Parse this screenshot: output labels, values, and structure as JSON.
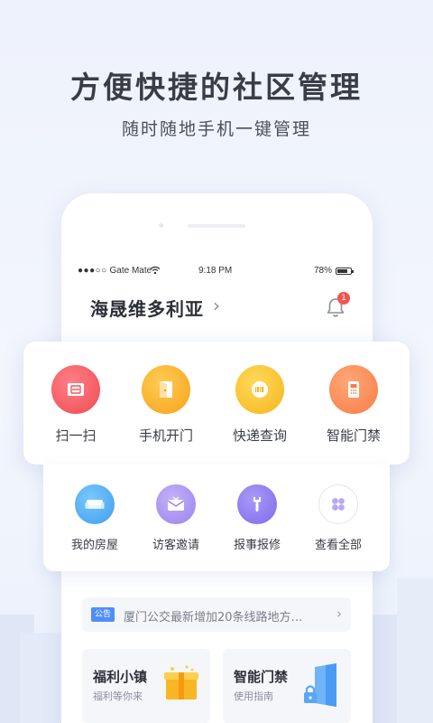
{
  "headline": "方便快捷的社区管理",
  "subline": "随时随地手机一键管理",
  "status_bar": {
    "carrier": "Gate Mate",
    "signal_dots": "●●●○○",
    "time": "9:18 PM",
    "battery": "78%",
    "battery_level": 0.78
  },
  "community": {
    "name": "海晟维多利亚",
    "chevron": "›"
  },
  "notifications": {
    "count": "1"
  },
  "quick_actions": [
    {
      "label": "扫一扫",
      "icon": "scan-icon",
      "color": "#f2565c"
    },
    {
      "label": "手机开门",
      "icon": "door-icon",
      "color": "#fbb22b"
    },
    {
      "label": "快递查询",
      "icon": "package-barcode-icon",
      "color": "#f7c32c"
    },
    {
      "label": "智能门禁",
      "icon": "access-control-icon",
      "color": "#fb8f58"
    }
  ],
  "secondary_actions": [
    {
      "label": "我的房屋",
      "icon": "sofa-icon",
      "color": "#4fb1f2"
    },
    {
      "label": "访客邀请",
      "icon": "envelope-icon",
      "color": "#a48ef0"
    },
    {
      "label": "报事报修",
      "icon": "wrench-icon",
      "color": "#8e7cf0"
    },
    {
      "label": "查看全部",
      "icon": "grid-icon",
      "color": "#ffffff"
    }
  ],
  "notice": {
    "tag": "公告",
    "text": "厦门公交最新增加20条线路地方…",
    "chevron": "›"
  },
  "tiles": [
    {
      "title": "福利小镇",
      "subtitle": "福利等你来",
      "icon": "gift-box-icon"
    },
    {
      "title": "智能门禁",
      "subtitle": "使用指南",
      "icon": "door-lock-icon"
    }
  ]
}
